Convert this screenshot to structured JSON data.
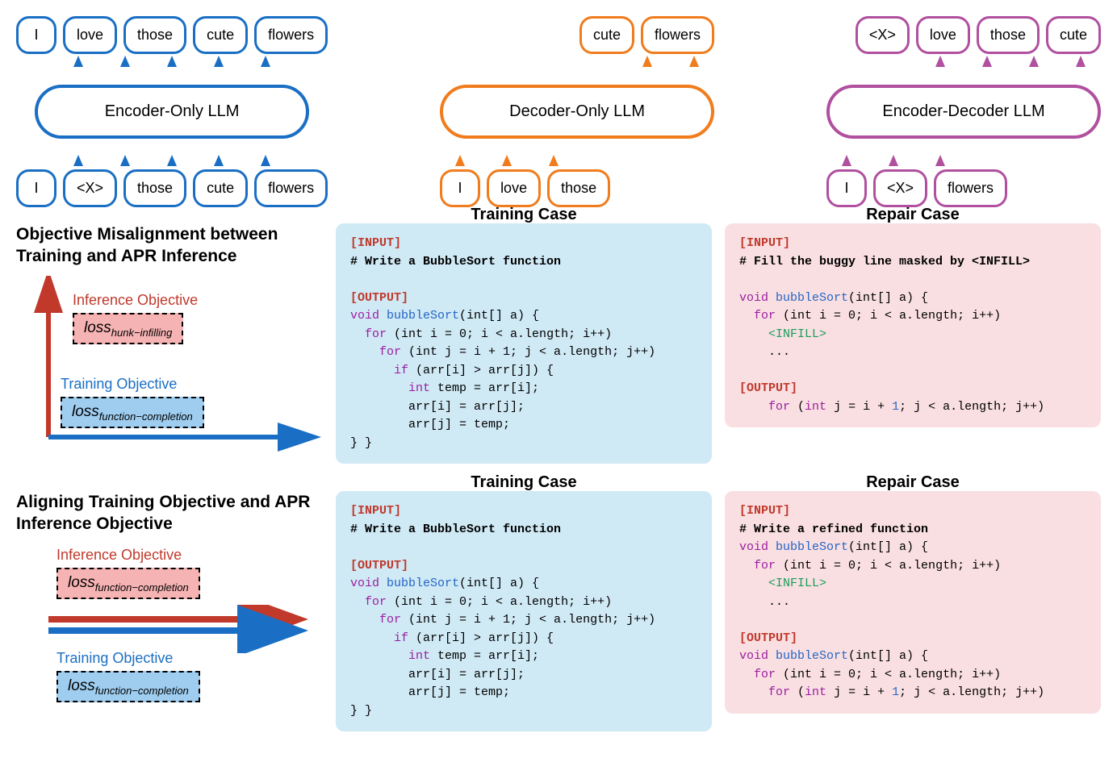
{
  "llms": {
    "encoder": {
      "label": "Encoder-Only LLM",
      "top": [
        "I",
        "love",
        "those",
        "cute",
        "flowers"
      ],
      "bottom": [
        "I",
        "<X>",
        "those",
        "cute",
        "flowers"
      ]
    },
    "decoder": {
      "label": "Decoder-Only LLM",
      "top": [
        "cute",
        "flowers"
      ],
      "bottom": [
        "I",
        "love",
        "those"
      ]
    },
    "encdec": {
      "label": "Encoder-Decoder LLM",
      "top": [
        "<X>",
        "love",
        "those",
        "cute"
      ],
      "bottom": [
        "I",
        "<X>",
        "flowers"
      ]
    }
  },
  "misalign": {
    "title": "Objective Misalignment between Training and APR Inference",
    "inference_label": "Inference Objective",
    "training_label": "Training Objective",
    "loss_inf": "loss",
    "loss_inf_sub": "hunk−infilling",
    "loss_train": "loss",
    "loss_train_sub": "function−completion"
  },
  "align": {
    "title": "Aligning Training Objective and APR Inference Objective",
    "inference_label": "Inference Objective",
    "training_label": "Training Objective",
    "loss_inf": "loss",
    "loss_inf_sub": "function−completion",
    "loss_train": "loss",
    "loss_train_sub": "function−completion"
  },
  "panels": {
    "train_title": "Training Case",
    "repair_title": "Repair Case",
    "input_label": "[INPUT]",
    "output_label": "[OUTPUT]",
    "train_comment": "# Write a BubbleSort function",
    "repair1_comment": "# Fill the buggy line masked by <INFILL>",
    "repair2_comment": "# Write a refined function",
    "infill_token": "<INFILL>",
    "ellipsis": "...",
    "code": {
      "sig_void": "void",
      "sig_fn": "bubbleSort",
      "sig_params": "(int[] a) {",
      "for_kw": "for",
      "int_kw": "int",
      "outer": " (int i = 0; i < a.length; i++)",
      "inner": " (int j = i + 1; j < a.length; j++)",
      "if_kw": "if",
      "if_cond": " (arr[i] > arr[j]) {",
      "temp_decl": "int temp = arr[i];",
      "swap1": "arr[i] = arr[j];",
      "swap2": "arr[j] = temp;",
      "close": "} }",
      "repair1_out": "for (int j = i + 1; j < a.length; j++)"
    }
  }
}
